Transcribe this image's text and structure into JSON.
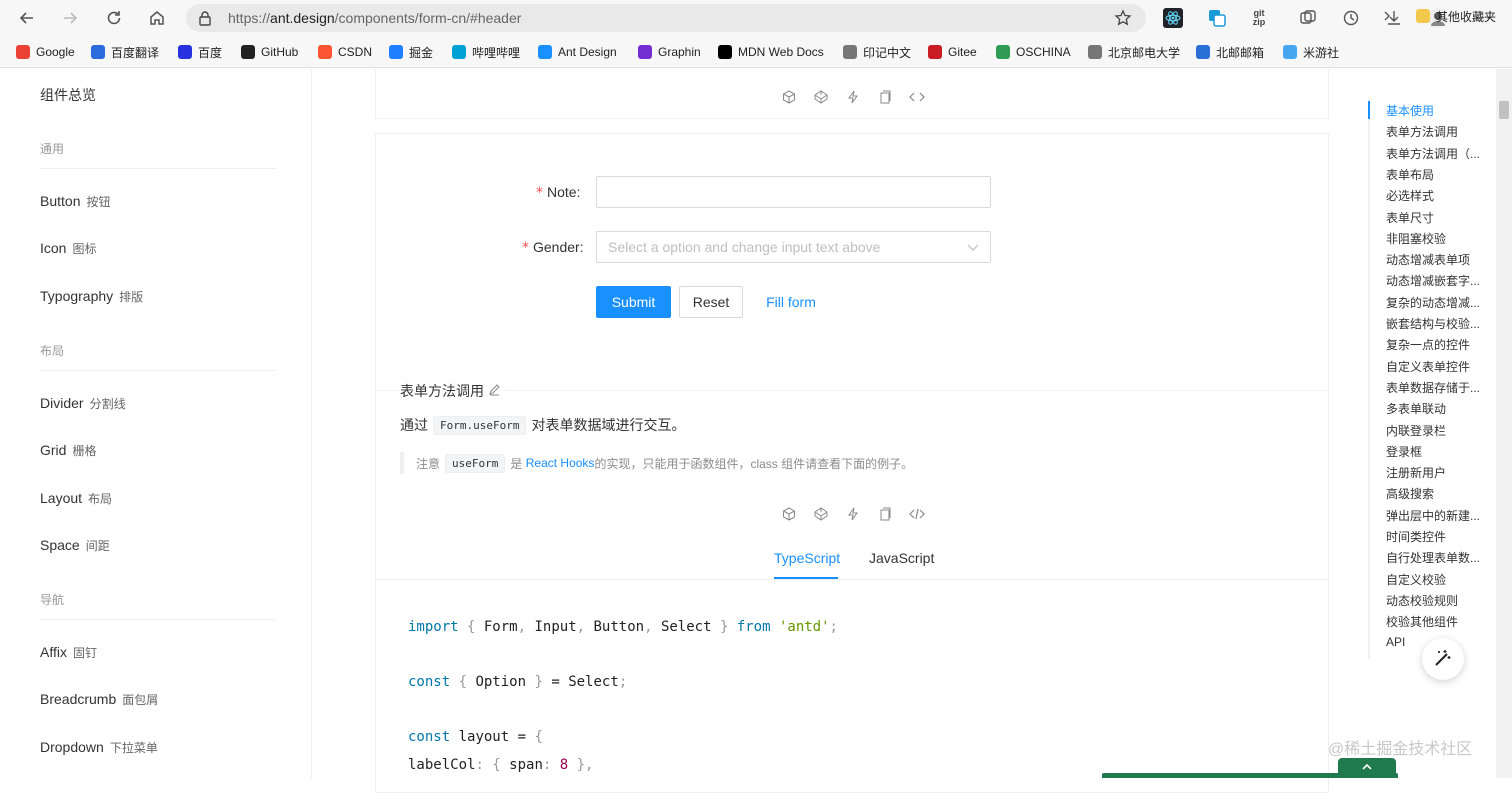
{
  "browser": {
    "url_prefix": "https://",
    "url_domain": "ant.design",
    "url_path": "/components/form-cn/#header",
    "ext_gitzip": "git zip"
  },
  "bookmarks": [
    {
      "label": "Google",
      "color": "#ea4335"
    },
    {
      "label": "百度翻译",
      "color": "#2b6cde"
    },
    {
      "label": "百度",
      "color": "#2932e1"
    },
    {
      "label": "GitHub",
      "color": "#222222"
    },
    {
      "label": "CSDN",
      "color": "#fc5531"
    },
    {
      "label": "掘金",
      "color": "#1e80ff"
    },
    {
      "label": "哔哩哔哩",
      "color": "#00a1d6"
    },
    {
      "label": "Ant Design",
      "color": "#1890ff"
    },
    {
      "label": "Graphin",
      "color": "#722ed1"
    },
    {
      "label": "MDN Web Docs",
      "color": "#000000"
    },
    {
      "label": "印记中文",
      "color": "#777777"
    },
    {
      "label": "Gitee",
      "color": "#c71d23"
    },
    {
      "label": "OSCHINA",
      "color": "#2f9b54"
    },
    {
      "label": "北京邮电大学",
      "color": "#777777"
    },
    {
      "label": "北邮邮箱",
      "color": "#2a6fd6"
    },
    {
      "label": "米游社",
      "color": "#46a6f0"
    }
  ],
  "bookmarks_other": "其他收藏夹",
  "sidebar": {
    "title": "组件总览",
    "group_general": "通用",
    "group_layout": "布局",
    "group_nav": "导航",
    "items": [
      {
        "en": "Button",
        "zh": "按钮"
      },
      {
        "en": "Icon",
        "zh": "图标"
      },
      {
        "en": "Typography",
        "zh": "排版"
      },
      {
        "en": "Divider",
        "zh": "分割线"
      },
      {
        "en": "Grid",
        "zh": "栅格"
      },
      {
        "en": "Layout",
        "zh": "布局"
      },
      {
        "en": "Space",
        "zh": "间距"
      },
      {
        "en": "Affix",
        "zh": "固钉"
      },
      {
        "en": "Breadcrumb",
        "zh": "面包屑"
      },
      {
        "en": "Dropdown",
        "zh": "下拉菜单"
      }
    ]
  },
  "form": {
    "note_label": "Note",
    "note_value": "",
    "gender_label": "Gender",
    "gender_placeholder": "Select a option and change input text above",
    "required_mark": "*",
    "colon": ":",
    "submit": "Submit",
    "reset": "Reset",
    "fill": "Fill form"
  },
  "section": {
    "title": "表单方法调用",
    "desc_before": "通过",
    "desc_code": "Form.useForm",
    "desc_after": "对表单数据域进行交互。",
    "note_prefix": "注意",
    "note_code": "useForm",
    "note_is": "是",
    "note_link": "React Hooks",
    "note_suffix": "的实现，只能用于函数组件，class 组件请查看下面的例子。"
  },
  "tabs": [
    "TypeScript",
    "JavaScript"
  ],
  "code": {
    "l1": {
      "kw1": "import",
      "p1": "{",
      "names": " Form",
      "c1": ",",
      "n2": " Input",
      "c2": ",",
      "n3": " Button",
      "c3": ",",
      "n4": " Select ",
      "p2": "}",
      "kw2": " from ",
      "str": "'antd'",
      "end": ";"
    },
    "l2": {
      "kw": "const",
      "p1": " {",
      "name": " Option ",
      "p2": "}",
      "eq": " = ",
      "val": "Select",
      "end": ";"
    },
    "l3": {
      "kw": "const",
      "name": " layout ",
      "eq": "=",
      "p": " {"
    },
    "l4": {
      "key": "  labelCol",
      "colon": ":",
      "p1": " {",
      "sub": " span",
      "colon2": ":",
      "num": " 8",
      "p2": " }",
      "end": ","
    }
  },
  "anchor": [
    "基本使用",
    "表单方法调用",
    "表单方法调用（...",
    "表单布局",
    "必选样式",
    "表单尺寸",
    "非阻塞校验",
    "动态增减表单项",
    "动态增减嵌套字...",
    "复杂的动态增减...",
    "嵌套结构与校验...",
    "复杂一点的控件",
    "自定义表单控件",
    "表单数据存储于...",
    "多表单联动",
    "内联登录栏",
    "登录框",
    "注册新用户",
    "高级搜索",
    "弹出层中的新建...",
    "时间类控件",
    "自行处理表单数...",
    "自定义校验",
    "动态校验规则",
    "校验其他组件",
    "API"
  ],
  "watermark": "@稀土掘金技术社区",
  "colors": {
    "primary": "#1890ff",
    "required": "#ff4d4f"
  }
}
